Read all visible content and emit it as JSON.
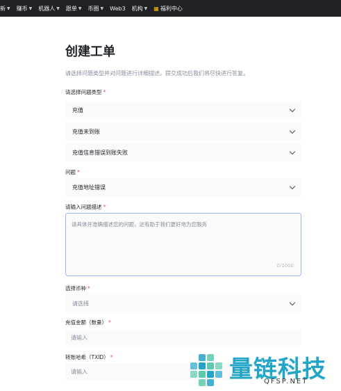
{
  "nav": {
    "items": [
      {
        "label": "新",
        "caret": true
      },
      {
        "label": "赚币",
        "caret": true
      },
      {
        "label": "机器人",
        "caret": true
      },
      {
        "label": "跟单",
        "caret": true
      },
      {
        "label": "币圈",
        "caret": true
      },
      {
        "label": "Web3",
        "caret": false
      },
      {
        "label": "机构",
        "caret": true
      },
      {
        "label": "福利中心",
        "caret": false,
        "icon": "gift-icon"
      }
    ]
  },
  "form": {
    "title": "创建工单",
    "subtitle": "请选择问题类型并对问题进行详细描述。提交成功后我们将尽快进行答复。",
    "issue_type_label": "请选择问题类型",
    "issue_type_levels": [
      "充值",
      "充值未到账",
      "充值信息错误到账失败"
    ],
    "question_label": "问题",
    "question_value": "充值地址错误",
    "description_label": "请输入问题描述",
    "description_placeholder": "请具体并准确描述您的问题，这有助于我们更好地为您服务",
    "description_count": "0/1000",
    "coin_label": "选择币种",
    "coin_placeholder": "请选择",
    "amount_label": "充值金额（数量）",
    "amount_placeholder": "请输入",
    "txid_label": "转账哈希（TXID）",
    "txid_placeholder": "请输入",
    "required_mark": "*"
  },
  "watermark": {
    "text": "量链科技",
    "sub": "QFSP.NET"
  },
  "colors": {
    "nav_bg": "#1f2126",
    "required": "#f6465d",
    "focus_border": "#9bb5ff",
    "watermark": "#23a5c7"
  }
}
